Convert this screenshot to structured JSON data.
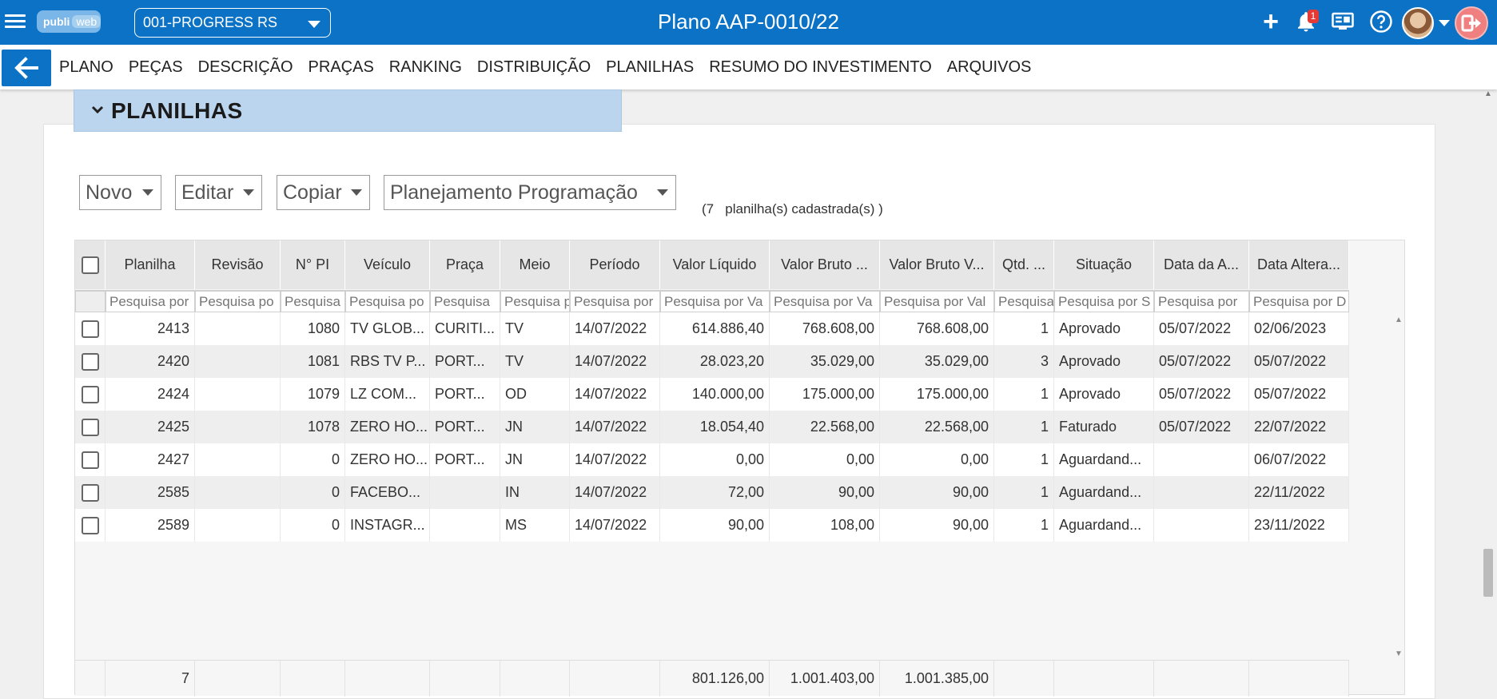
{
  "header": {
    "logo_main": "publi",
    "logo_sub": "web",
    "company": "001-PROGRESS RS",
    "title": "Plano AAP-0010/22",
    "notifications_count": "1",
    "icons": [
      "menu-icon",
      "plus-icon",
      "bell-icon",
      "monitor-icon",
      "help-icon",
      "avatar",
      "logout-icon"
    ]
  },
  "nav": {
    "items": [
      "PLANO",
      "PEÇAS",
      "DESCRIÇÃO",
      "PRAÇAS",
      "RANKING",
      "DISTRIBUIÇÃO",
      "PLANILHAS",
      "RESUMO DO INVESTIMENTO",
      "ARQUIVOS"
    ]
  },
  "section": {
    "title": "PLANILHAS"
  },
  "toolbar": {
    "novo": "Novo",
    "editar": "Editar",
    "copiar": "Copiar",
    "planejamento": "Planejamento Programação",
    "count_text": "(7   planilha(s) cadastrada(s) )"
  },
  "grid": {
    "columns": [
      "Planilha",
      "Revisão",
      "N° PI",
      "Veículo",
      "Praça",
      "Meio",
      "Período",
      "Valor Líquido",
      "Valor Bruto ...",
      "Valor Bruto V...",
      "Qtd. ...",
      "Situação",
      "Data da A...",
      "Data Altera..."
    ],
    "filters": [
      "Pesquisa por",
      "Pesquisa po",
      "Pesquisa",
      "Pesquisa po",
      "Pesquisa",
      "Pesquisa p",
      "Pesquisa por",
      "Pesquisa por Va",
      "Pesquisa por Va",
      "Pesquisa por Val",
      "Pesquisa",
      "Pesquisa por S",
      "Pesquisa por",
      "Pesquisa por D"
    ],
    "rows": [
      [
        "2413",
        "",
        "1080",
        "TV GLOB...",
        "CURITI...",
        "TV",
        "14/07/2022",
        "614.886,40",
        "768.608,00",
        "768.608,00",
        "1",
        "Aprovado",
        "05/07/2022",
        "02/06/2023"
      ],
      [
        "2420",
        "",
        "1081",
        "RBS TV P...",
        "PORT...",
        "TV",
        "14/07/2022",
        "28.023,20",
        "35.029,00",
        "35.029,00",
        "3",
        "Aprovado",
        "05/07/2022",
        "05/07/2022"
      ],
      [
        "2424",
        "",
        "1079",
        "LZ COM...",
        "PORT...",
        "OD",
        "14/07/2022",
        "140.000,00",
        "175.000,00",
        "175.000,00",
        "1",
        "Aprovado",
        "05/07/2022",
        "05/07/2022"
      ],
      [
        "2425",
        "",
        "1078",
        "ZERO HO...",
        "PORT...",
        "JN",
        "14/07/2022",
        "18.054,40",
        "22.568,00",
        "22.568,00",
        "1",
        "Faturado",
        "05/07/2022",
        "22/07/2022"
      ],
      [
        "2427",
        "",
        "0",
        "ZERO HO...",
        "PORT...",
        "JN",
        "14/07/2022",
        "0,00",
        "0,00",
        "0,00",
        "1",
        "Aguardand...",
        "",
        "06/07/2022"
      ],
      [
        "2585",
        "",
        "0",
        "FACEBO...",
        "",
        "IN",
        "14/07/2022",
        "72,00",
        "90,00",
        "90,00",
        "1",
        "Aguardand...",
        "",
        "22/11/2022"
      ],
      [
        "2589",
        "",
        "0",
        "INSTAGR...",
        "",
        "MS",
        "14/07/2022",
        "90,00",
        "108,00",
        "90,00",
        "1",
        "Aguardand...",
        "",
        "23/11/2022"
      ]
    ],
    "footer": [
      "7",
      "",
      "",
      "",
      "",
      "",
      "",
      "801.126,00",
      "1.001.403,00",
      "1.001.385,00",
      "",
      "",
      "",
      ""
    ]
  },
  "colors": {
    "primary": "#0b72c5",
    "section_header": "#bcd5ee",
    "badge": "#e53935"
  }
}
